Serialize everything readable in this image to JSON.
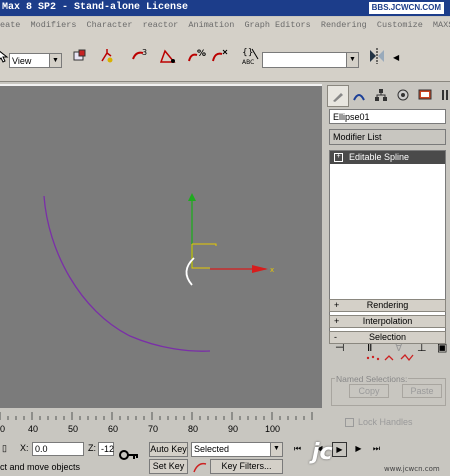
{
  "title": "Max 8 SP2  - Stand-alone License",
  "watermark_top": "BBS.JCWCN.COM",
  "menu": [
    "eate",
    "Modifiers",
    "Character",
    "reactor",
    "Animation",
    "Graph Editors",
    "Rendering",
    "Customize",
    "MAXScrip"
  ],
  "toolbar": {
    "view_value": "View",
    "selection_set_value": ""
  },
  "icons": {
    "select": "cursor-icon",
    "link": "link-icon",
    "move": "move-icon",
    "rotate": "rotate-icon",
    "angle_snap": "angle-snap-icon",
    "percent_snap": "percent-snap-icon",
    "spinner_snap": "spinner-snap-icon",
    "edit_named": "edit-named-icon",
    "mirror": "mirror-icon"
  },
  "command_panel": {
    "object_name": "Ellipse01",
    "modifier_list": "Modifier List",
    "stack_item": "Editable Spline",
    "rollouts": [
      {
        "sign": "+",
        "label": "Rendering"
      },
      {
        "sign": "+",
        "label": "Interpolation"
      },
      {
        "sign": "-",
        "label": "Selection"
      }
    ],
    "named_selections": "Named Selections:",
    "copy": "Copy",
    "paste": "Paste",
    "lock_handles": "Lock Handles"
  },
  "ruler": {
    "ticks": [
      "0",
      "40",
      "50",
      "60",
      "70",
      "80",
      "90",
      "100"
    ]
  },
  "status": {
    "x_label": "X:",
    "x_value": "0.0",
    "z_label": "Z:",
    "z_value": "-12",
    "auto_key": "Auto Key",
    "selected": "Selected",
    "set_key": "Set Key",
    "key_filters": "Key Filters...",
    "prompt": "ct and move objects"
  },
  "watermark_logo": "jc",
  "watermark_url": "www.jcwcn.com",
  "colors": {
    "viewport_bg": "#7b7b7b",
    "spline": "#7a2ea8",
    "axis_y": "#1faa1f",
    "axis_x": "#d71c1c",
    "gizmo": "#e6c800"
  }
}
